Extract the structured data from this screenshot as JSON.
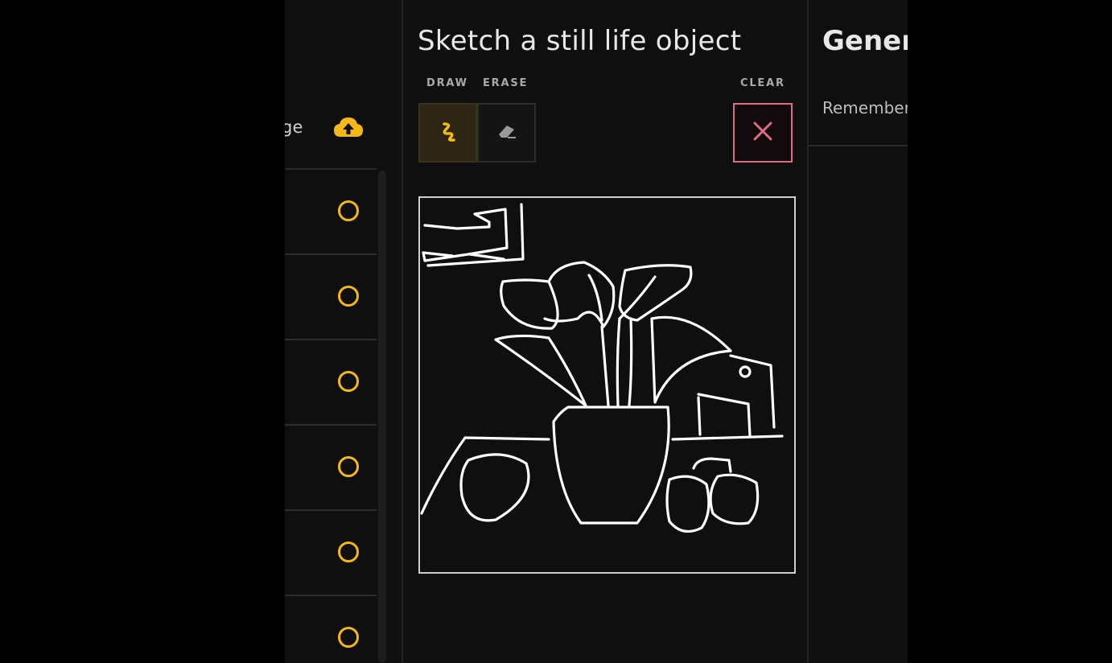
{
  "left_panel": {
    "upload_label_fragment": "ge",
    "upload_icon": "cloud-upload-icon",
    "list_items": [
      {
        "status_icon": "circle-ring-icon"
      },
      {
        "status_icon": "circle-ring-icon"
      },
      {
        "status_icon": "circle-ring-icon"
      },
      {
        "status_icon": "circle-ring-icon"
      },
      {
        "status_icon": "circle-ring-icon"
      },
      {
        "status_icon": "circle-ring-icon"
      }
    ]
  },
  "sketch_panel": {
    "title": "Sketch a still life object",
    "tools": {
      "draw_label": "DRAW",
      "draw_icon": "squiggle-pen-icon",
      "erase_label": "ERASE",
      "erase_icon": "eraser-icon",
      "clear_label": "CLEAR",
      "clear_icon": "close-icon",
      "active_tool": "DRAW"
    },
    "canvas_content": "hand-drawn sketch"
  },
  "right_panel": {
    "title_fragment": "Genera",
    "note_fragment": "Remember"
  },
  "colors": {
    "accent_yellow": "#f5b817",
    "clear_pink": "#e06b85",
    "background": "#0f0f0f"
  }
}
